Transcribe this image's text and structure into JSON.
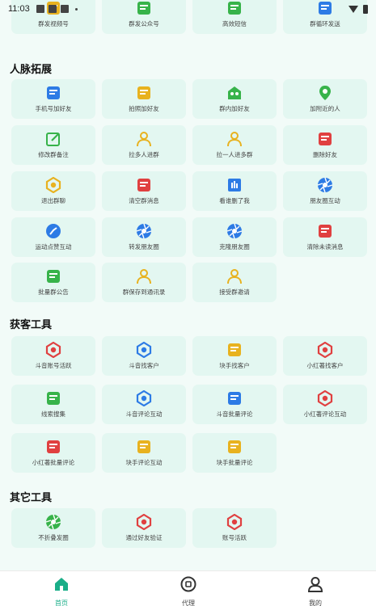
{
  "status_bar": {
    "time": "11:03"
  },
  "top_row": [
    {
      "label": "群发视频号",
      "icon": "video-icon",
      "color": "#e8b21f"
    },
    {
      "label": "群发公众号",
      "icon": "wechat-icon",
      "color": "#37b34a"
    },
    {
      "label": "高效短信",
      "icon": "message-icon",
      "color": "#37b34a"
    },
    {
      "label": "群循环发送",
      "icon": "loop-icon",
      "color": "#2d7be5"
    }
  ],
  "sections": {
    "network": {
      "title": "人脉拓展",
      "items": [
        {
          "label": "手机号加好友",
          "icon": "phone-contact-icon",
          "color": "#2d7be5"
        },
        {
          "label": "拍照加好友",
          "icon": "camera-icon",
          "color": "#e8b21f"
        },
        {
          "label": "群内加好友",
          "icon": "group-icon",
          "color": "#37b34a"
        },
        {
          "label": "加附近的人",
          "icon": "location-icon",
          "color": "#37b34a"
        },
        {
          "label": "修改群备注",
          "icon": "edit-icon",
          "color": "#37b34a"
        },
        {
          "label": "拉多人进群",
          "icon": "add-user-icon",
          "color": "#e8b21f"
        },
        {
          "label": "拉一人进多群",
          "icon": "add-user-icon",
          "color": "#e8b21f"
        },
        {
          "label": "删除好友",
          "icon": "trash-icon",
          "color": "#e04040"
        },
        {
          "label": "退出群聊",
          "icon": "exit-icon",
          "color": "#e8b21f"
        },
        {
          "label": "清空群消息",
          "icon": "clear-icon",
          "color": "#e04040"
        },
        {
          "label": "看谁删了我",
          "icon": "scan-icon",
          "color": "#2d7be5"
        },
        {
          "label": "朋友圈互动",
          "icon": "aperture-icon",
          "color": "#2d7be5"
        },
        {
          "label": "运动点赞互动",
          "icon": "run-icon",
          "color": "#2d7be5"
        },
        {
          "label": "转发朋友圈",
          "icon": "aperture-icon",
          "color": "#2d7be5"
        },
        {
          "label": "克隆朋友圈",
          "icon": "aperture-icon",
          "color": "#2d7be5"
        },
        {
          "label": "清除未读消息",
          "icon": "clear-icon",
          "color": "#e04040"
        },
        {
          "label": "批量群公告",
          "icon": "notice-icon",
          "color": "#37b34a"
        },
        {
          "label": "群保存到通讯录",
          "icon": "save-contact-icon",
          "color": "#e8b21f"
        },
        {
          "label": "接受群邀请",
          "icon": "accept-user-icon",
          "color": "#e8b21f"
        }
      ]
    },
    "acquire": {
      "title": "获客工具",
      "items": [
        {
          "label": "斗音账号活跃",
          "icon": "pulse-icon",
          "color": "#e04040"
        },
        {
          "label": "斗音找客户",
          "icon": "tiktok-icon",
          "color": "#2d7be5"
        },
        {
          "label": "块手找客户",
          "icon": "hand-icon",
          "color": "#e8b21f"
        },
        {
          "label": "小红著找客户",
          "icon": "red-book-icon",
          "color": "#e04040"
        },
        {
          "label": "线索搜集",
          "icon": "tv-icon",
          "color": "#37b34a"
        },
        {
          "label": "斗音评论互动",
          "icon": "comment-icon",
          "color": "#2d7be5"
        },
        {
          "label": "斗音批量评论",
          "icon": "doc-icon",
          "color": "#2d7be5"
        },
        {
          "label": "小红著评论互动",
          "icon": "comment-icon",
          "color": "#e04040"
        },
        {
          "label": "小红著批量评论",
          "icon": "doc-icon",
          "color": "#e04040"
        },
        {
          "label": "块手评论互动",
          "icon": "send-icon",
          "color": "#e8b21f"
        },
        {
          "label": "块手批量评论",
          "icon": "chat-list-icon",
          "color": "#e8b21f"
        }
      ]
    },
    "other": {
      "title": "其它工具",
      "items": [
        {
          "label": "不折叠发圈",
          "icon": "aperture-icon",
          "color": "#37b34a"
        },
        {
          "label": "通过好友验证",
          "icon": "verify-icon",
          "color": "#e04040"
        },
        {
          "label": "账号活跃",
          "icon": "active-icon",
          "color": "#e04040"
        }
      ]
    }
  },
  "bottom_nav": [
    {
      "label": "首页",
      "icon": "home-icon",
      "active": true
    },
    {
      "label": "代理",
      "icon": "agent-icon",
      "active": false
    },
    {
      "label": "我的",
      "icon": "profile-icon",
      "active": false
    }
  ],
  "colors": {
    "accent": "#1aae88",
    "card_bg": "#e3f7f1",
    "page_bg": "#f2fbf8"
  }
}
